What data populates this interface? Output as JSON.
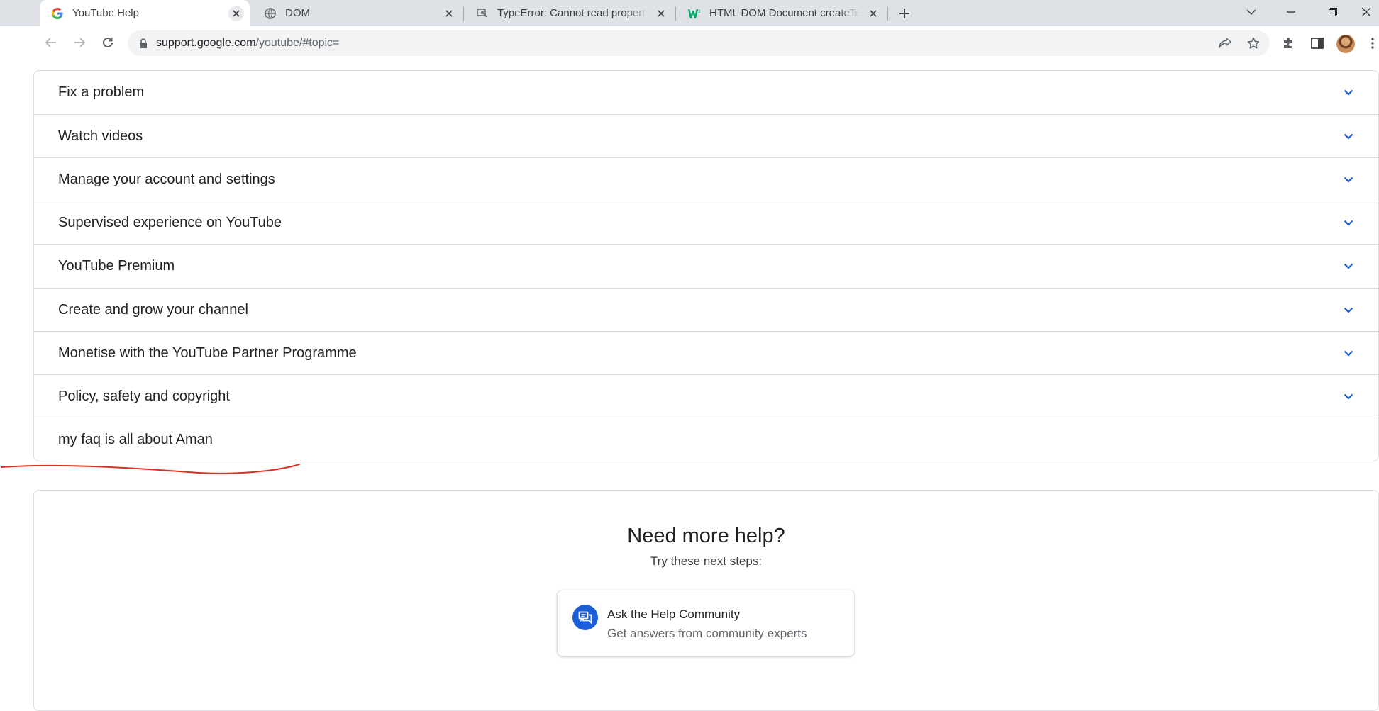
{
  "browser": {
    "tabs": [
      {
        "title": "YouTube Help",
        "favicon": "google-g-icon",
        "active": true
      },
      {
        "title": "DOM",
        "favicon": "globe-icon",
        "active": false
      },
      {
        "title": "TypeError: Cannot read property",
        "favicon": "stackoverflow-icon",
        "active": false
      },
      {
        "title": "HTML DOM Document createTextNode",
        "favicon": "w3schools-icon",
        "active": false
      }
    ],
    "url_host": "support.google.com",
    "url_path": "/youtube/#topic="
  },
  "faq": {
    "items": [
      {
        "label": "Fix a problem"
      },
      {
        "label": "Watch videos"
      },
      {
        "label": "Manage your account and settings"
      },
      {
        "label": "Supervised experience on YouTube"
      },
      {
        "label": "YouTube Premium"
      },
      {
        "label": "Create and grow your channel"
      },
      {
        "label": "Monetise with the YouTube Partner Programme"
      },
      {
        "label": "Policy, safety and copyright"
      },
      {
        "label": "my faq is all about Aman"
      }
    ]
  },
  "help": {
    "title": "Need more help?",
    "subtitle": "Try these next steps:",
    "community_title": "Ask the Help Community",
    "community_desc": "Get answers from community experts"
  },
  "colors": {
    "accent": "#1a73e8",
    "chevron": "#1a5fd8",
    "annotation": "#d93025"
  }
}
